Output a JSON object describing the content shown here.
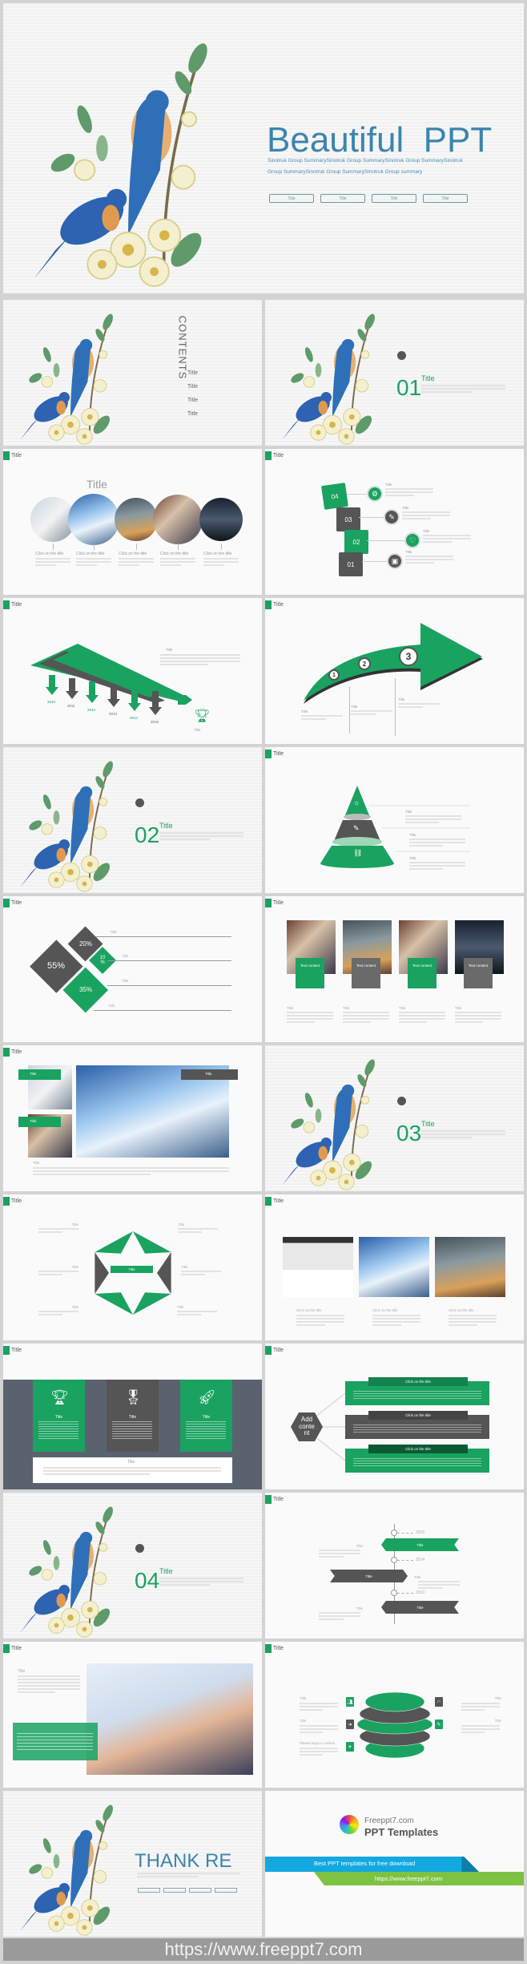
{
  "colors": {
    "green": "#1aa260",
    "gray": "#555555",
    "blue": "#3b85ad",
    "ribbon_blue": "#13a8e0",
    "ribbon_green": "#7dc242"
  },
  "cover": {
    "title": "Beautiful  PPT",
    "summary_1": "Sinotruk Group SummarySinotruk Group SummarySinotruk Group SummarySinotruk",
    "summary_2": "Group SummarySinotruk Group SummarySinotruk Group summary",
    "buttons": [
      "Title",
      "Title",
      "Title",
      "Title"
    ]
  },
  "header_title": "Title",
  "contents": {
    "heading": "CONTENTS",
    "items": [
      "Title",
      "Title",
      "Title",
      "Title"
    ]
  },
  "sections": [
    {
      "num": "01",
      "title": "Title"
    },
    {
      "num": "02",
      "title": "Title"
    },
    {
      "num": "03",
      "title": "Title"
    },
    {
      "num": "04",
      "title": "Title"
    }
  ],
  "circles_slide": {
    "title": "Title",
    "labels": [
      "Click on the title",
      "Click on the title",
      "Click on the title",
      "Click on the title",
      "Click on the title"
    ]
  },
  "steps_slide": {
    "steps": [
      "04",
      "03",
      "02",
      "01"
    ],
    "titles": [
      "Title",
      "Title",
      "Title",
      "Title"
    ],
    "icons": [
      "gear-icon",
      "pencil-icon",
      "heart-icon",
      "monitor-icon"
    ]
  },
  "stairs_slide": {
    "years": [
      "2010",
      "2011",
      "2012",
      "2013",
      "2014",
      "2015"
    ],
    "goal": "Title",
    "text_title": "Title"
  },
  "arrow_slide": {
    "steps": [
      "1",
      "2",
      "3"
    ],
    "titles": [
      "Title",
      "Title",
      "Title"
    ]
  },
  "pyramid_slide": {
    "titles": [
      "Title",
      "Title",
      "Title"
    ],
    "icons": [
      "sun-icon",
      "pencil-icon",
      "link-icon"
    ]
  },
  "diamond_slide": {
    "values": [
      "55%",
      "20%",
      "10\n%",
      "35%"
    ],
    "titles": [
      "Title",
      "Title",
      "Title",
      "Title"
    ]
  },
  "photo4_slide": {
    "labels": [
      "Text content",
      "Text content",
      "Text content",
      "Text content"
    ],
    "titles": [
      "Title",
      "Title",
      "Title",
      "Title"
    ]
  },
  "gallery_slide": {
    "tabs": [
      "Title",
      "Title",
      "Title"
    ],
    "caption": "Title"
  },
  "star_slide": {
    "center": "Title",
    "titles": [
      "Title",
      "Title",
      "Title",
      "Title",
      "Title",
      "Title"
    ]
  },
  "photo3_slide": {
    "labels": [
      "Click on the title",
      "Click on the title",
      "Click on the title"
    ]
  },
  "columns_slide": {
    "titles": [
      "Title",
      "Title",
      "Title"
    ],
    "icons": [
      "trophy-icon",
      "medal-icon",
      "rocket-icon"
    ],
    "box_title": "Title"
  },
  "branch_slide": {
    "center": "Add\nconte\nnt",
    "items": [
      "Click on the title",
      "Click on the title",
      "Click on the title"
    ]
  },
  "timeline_slide": {
    "years": [
      "2015",
      "2014",
      "2013"
    ],
    "ribbons": [
      "Title",
      "Title",
      "Title"
    ],
    "titles": [
      "Title",
      "Title",
      "Title"
    ]
  },
  "handshake_slide": {
    "title": "Title"
  },
  "layers_slide": {
    "titles": [
      "Title",
      "Title",
      "Please input a custom",
      "Title",
      "Title"
    ]
  },
  "thanks": {
    "title": "THANK RE"
  },
  "brand": {
    "line1": "Freeppt7.com",
    "line2": "PPT Templates",
    "tagline": "Best PPT templates for free download",
    "url": "https://www.freeppt7.com"
  },
  "footer_url": "https://www.freeppt7.com"
}
